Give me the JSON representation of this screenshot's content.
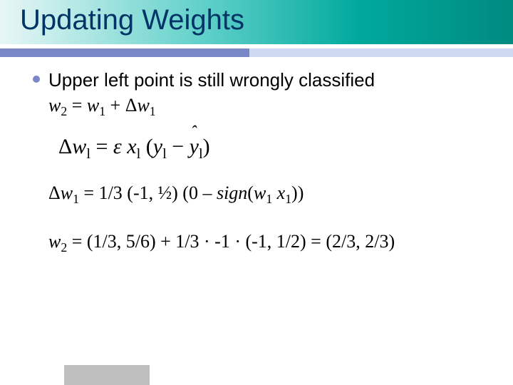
{
  "title": "Updating Weights",
  "bullet": "Upper left point is still wrongly classified",
  "eq1": {
    "lhs_var": "w",
    "lhs_sub": "2",
    "r1_var": "w",
    "r1_sub": "1",
    "plus": " + ",
    "delta": "Δ",
    "r2_var": "w",
    "r2_sub": "1",
    "eq": " = "
  },
  "formula": {
    "delta": "Δ",
    "w": "w",
    "sub1": "1",
    "eq": " = ",
    "eps": "ε",
    "sp1": " ",
    "x": "x",
    "lp": " (",
    "y": "y",
    "minus": " − ",
    "yhat": "y",
    "rp": ")",
    "sub_l": "l"
  },
  "eq2": {
    "delta": "Δ",
    "var": "w",
    "sub": "1",
    "eq": " = 1/3 (-1, ½) (0 – ",
    "sign": "sign",
    "lp": "(",
    "w": "w",
    "wsub": "1",
    "sp": " ",
    "x": "x",
    "xsub": "1",
    "rp": "))"
  },
  "eq3": {
    "var": "w",
    "sub": "2",
    "tail": " = (1/3, 5/6) + 1/3 · -1 · (-1, 1/2) = (2/3, 2/3)"
  }
}
